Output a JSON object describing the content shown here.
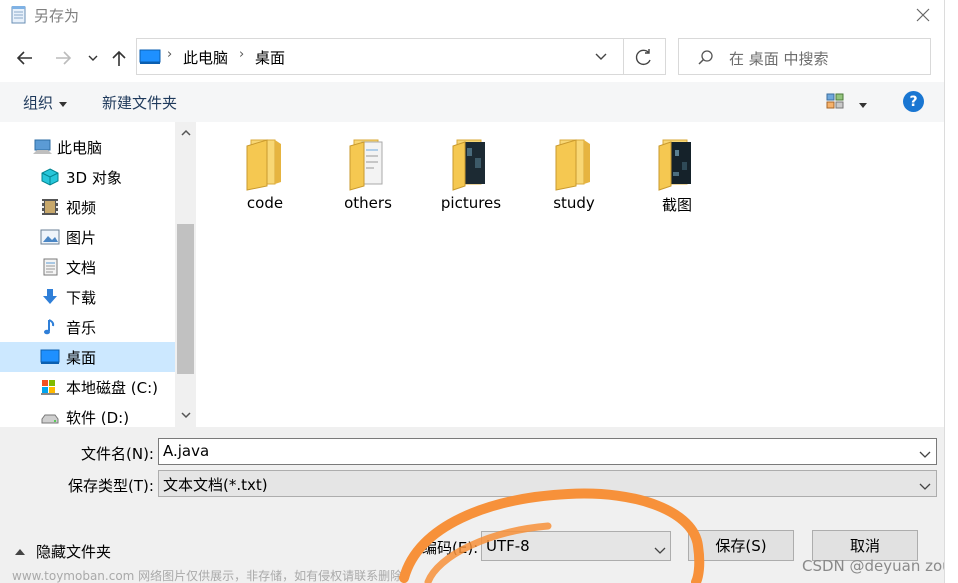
{
  "window": {
    "title": "另存为"
  },
  "address_bar": {
    "segments": [
      "此电脑",
      "桌面"
    ],
    "separator": "›"
  },
  "search": {
    "placeholder": "在 桌面 中搜索"
  },
  "command_bar": {
    "organize_label": "组织",
    "new_folder_label": "新建文件夹",
    "help_label": "?"
  },
  "nav_pane": {
    "items": [
      {
        "label": "此电脑",
        "icon": "computer-icon"
      },
      {
        "label": "3D 对象",
        "icon": "cube-3d-icon"
      },
      {
        "label": "视频",
        "icon": "video-icon"
      },
      {
        "label": "图片",
        "icon": "picture-icon"
      },
      {
        "label": "文档",
        "icon": "document-icon"
      },
      {
        "label": "下载",
        "icon": "download-icon"
      },
      {
        "label": "音乐",
        "icon": "music-icon"
      },
      {
        "label": "桌面",
        "icon": "desktop-icon",
        "selected": true
      },
      {
        "label": "本地磁盘 (C:)",
        "icon": "drive-c-icon"
      },
      {
        "label": "软件 (D:)",
        "icon": "drive-icon"
      }
    ]
  },
  "files": [
    {
      "name": "code",
      "variant": "plain"
    },
    {
      "name": "others",
      "variant": "paper"
    },
    {
      "name": "pictures",
      "variant": "dark"
    },
    {
      "name": "study",
      "variant": "plain"
    },
    {
      "name": "截图",
      "variant": "dark"
    }
  ],
  "form": {
    "filename_label": "文件名(N):",
    "filename_value": "A.java",
    "type_label": "保存类型(T):",
    "type_value": "文本文档(*.txt)",
    "encoding_label": "编码(E):",
    "encoding_value": "UTF-8",
    "hide_folders_label": "隐藏文件夹",
    "save_label": "保存(S)",
    "cancel_label": "取消"
  },
  "watermarks": {
    "left": "www.toymoban.com 网络图片仅供展示，非存储，如有侵权请联系删除。",
    "right": "CSDN @deyuan zou"
  },
  "colors": {
    "accent_blue": "#1976d2",
    "selection": "#cce8ff",
    "annotation_orange": "#f7913a",
    "folder_yellow": "#f5c851"
  }
}
